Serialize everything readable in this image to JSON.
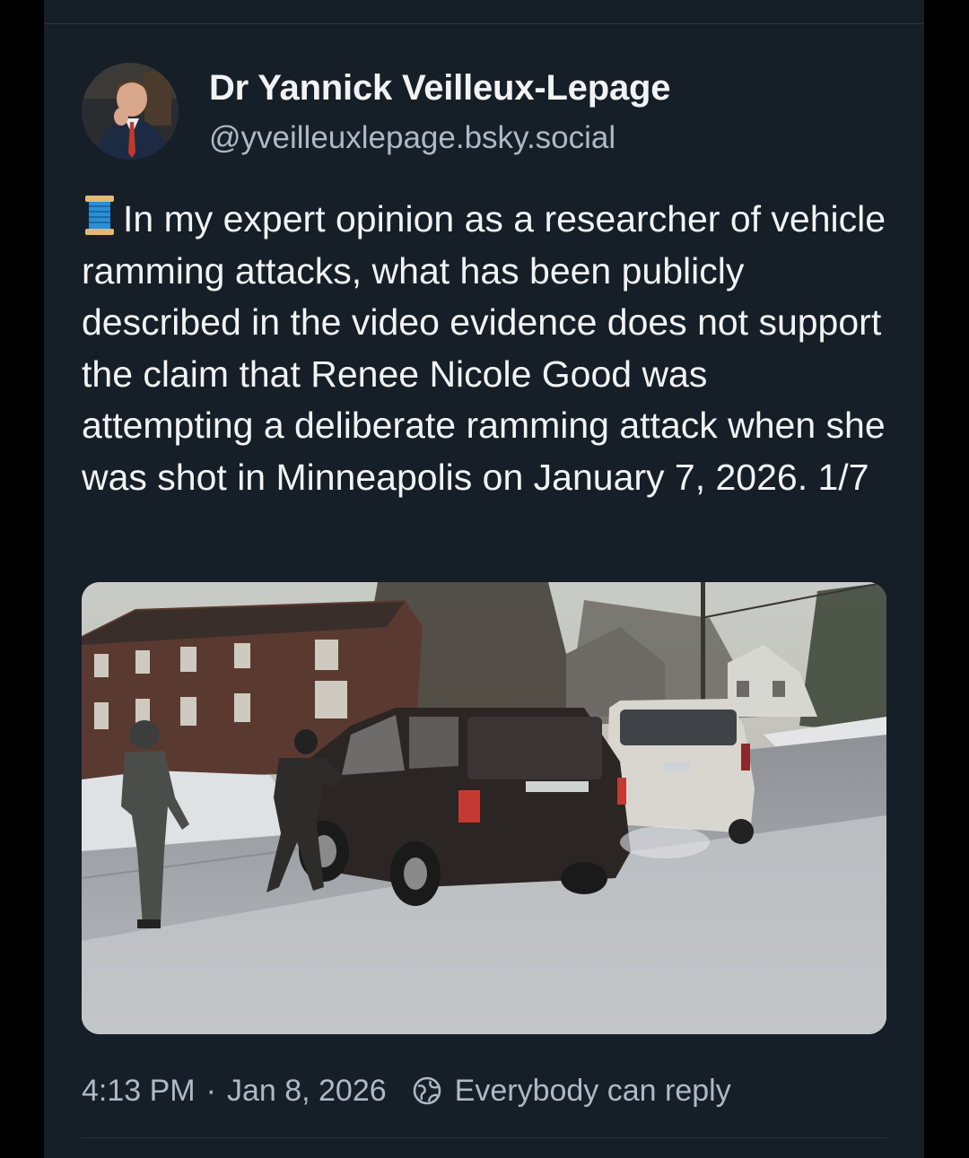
{
  "author": {
    "display_name": "Dr Yannick Veilleux-Lepage",
    "handle": "@yveilleuxlepage.bsky.social"
  },
  "post": {
    "thread_icon": "spool-of-thread-emoji",
    "text": "In my expert opinion as a researcher of vehicle ramming attacks, what has been publicly described in the video evidence does not support the claim that Renee Nicole Good was attempting a deliberate ramming attack when she was shot in Minneapolis on January 7, 2026. 1/7"
  },
  "meta": {
    "time": "4:13 PM",
    "separator": "·",
    "date": "Jan 8, 2026",
    "reply_setting": "Everybody can reply",
    "reply_icon": "globe-icon"
  },
  "colors": {
    "background": "#161e27",
    "outer": "#000000",
    "text_primary": "#f1f3f5",
    "text_secondary": "#aeb9c5",
    "divider": "#2a3541"
  }
}
